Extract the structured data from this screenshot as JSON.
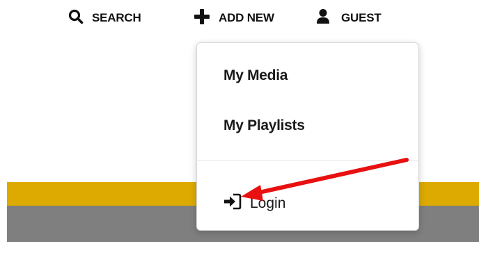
{
  "topnav": {
    "search": {
      "label": "SEARCH",
      "icon": "search-icon"
    },
    "add_new": {
      "label": "ADD NEW",
      "icon": "plus-icon"
    },
    "guest": {
      "label": "GUEST",
      "icon": "user-icon"
    }
  },
  "dropdown": {
    "items": [
      {
        "label": "My Media"
      },
      {
        "label": "My Playlists"
      }
    ],
    "login": {
      "label": "Login",
      "icon": "sign-in-icon"
    }
  },
  "colors": {
    "accent_yellow": "#dcaa00",
    "band_gray": "#7f7f7f",
    "annotation_red": "#e81010",
    "text_dark": "#111111"
  },
  "annotation": {
    "type": "arrow",
    "color": "#e81010",
    "points_to": "login-item"
  }
}
